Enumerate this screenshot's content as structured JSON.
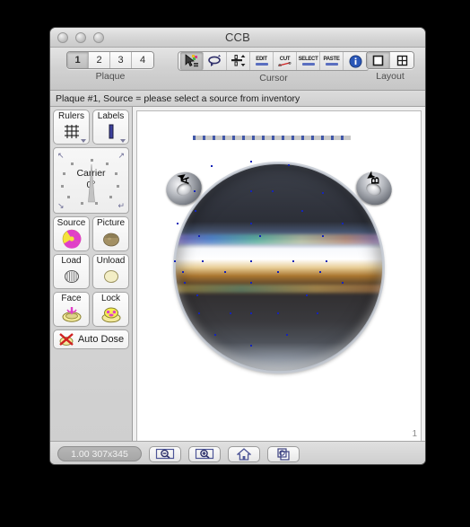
{
  "window": {
    "title": "CCB",
    "traffic_lights": [
      "close-button",
      "minimize-button",
      "zoom-button"
    ]
  },
  "toolbar": {
    "plaque": {
      "label": "Plaque",
      "segments": [
        {
          "label": "1",
          "selected": true
        },
        {
          "label": "2",
          "selected": false
        },
        {
          "label": "3",
          "selected": false
        },
        {
          "label": "4",
          "selected": false
        }
      ]
    },
    "cursor": {
      "label": "Cursor",
      "buttons": [
        {
          "name": "arrow-select-tool",
          "label": "",
          "pressed": true
        },
        {
          "name": "rotate-tool",
          "label": "",
          "pressed": false
        },
        {
          "name": "move-adjust-tool",
          "label": "",
          "pressed": false
        },
        {
          "name": "edit-tool",
          "label": "EDIT",
          "pressed": false
        },
        {
          "name": "cut-tool",
          "label": "CUT",
          "pressed": false
        },
        {
          "name": "select-tool",
          "label": "SELECT",
          "pressed": false
        },
        {
          "name": "paste-tool",
          "label": "PASTE",
          "pressed": false
        },
        {
          "name": "info-tool",
          "label": "",
          "pressed": false
        }
      ]
    },
    "layout": {
      "label": "Layout",
      "segments": [
        {
          "name": "layout-single-view",
          "selected": true
        },
        {
          "name": "layout-quad-view",
          "selected": false
        }
      ]
    }
  },
  "status": {
    "message": "Plaque #1, Source = please select a source from inventory"
  },
  "sidebar": {
    "rows": [
      [
        {
          "name": "rulers-button",
          "label": "Rulers",
          "icon": "grid-icon",
          "has_disclosure": true
        },
        {
          "name": "labels-button",
          "label": "Labels",
          "icon": "bar-icon",
          "has_disclosure": true
        }
      ],
      [
        {
          "name": "source-button",
          "label": "Source",
          "icon": "radiation-icon",
          "has_disclosure": false
        },
        {
          "name": "picture-button",
          "label": "Picture",
          "icon": "potato-icon",
          "has_disclosure": false
        }
      ],
      [
        {
          "name": "load-button",
          "label": "Load",
          "icon": "load-disc-icon",
          "has_disclosure": false
        },
        {
          "name": "unload-button",
          "label": "Unload",
          "icon": "unload-disc-icon",
          "has_disclosure": false
        }
      ],
      [
        {
          "name": "face-button",
          "label": "Face",
          "icon": "face-dish-icon",
          "has_disclosure": false
        },
        {
          "name": "lock-button",
          "label": "Lock",
          "icon": "lock-dish-icon",
          "has_disclosure": false
        }
      ]
    ],
    "carrier": {
      "name": "carrier-dial",
      "label": "Carrier",
      "value": "0°"
    },
    "auto_dose": {
      "name": "auto-dose-button",
      "label": "Auto Dose",
      "icon": "no-dose-icon"
    }
  },
  "canvas": {
    "page_number": "1",
    "marker_a": "A",
    "marker_b": "B",
    "ruler_name": "dashed-ruler"
  },
  "bottombar": {
    "zoom_readout": "1.00 307x345",
    "buttons": [
      {
        "name": "zoom-out-button",
        "icon": "zoom-out-icon"
      },
      {
        "name": "zoom-in-button",
        "icon": "zoom-in-icon"
      },
      {
        "name": "home-button",
        "icon": "home-icon"
      },
      {
        "name": "duplicate-view-button",
        "icon": "duplicate-icon"
      }
    ]
  },
  "colors": {
    "accent_blue": "#4158a8",
    "marker_blue": "#1524b8",
    "radiation_magenta": "#e040c8",
    "radiation_yellow": "#f5e23c"
  }
}
